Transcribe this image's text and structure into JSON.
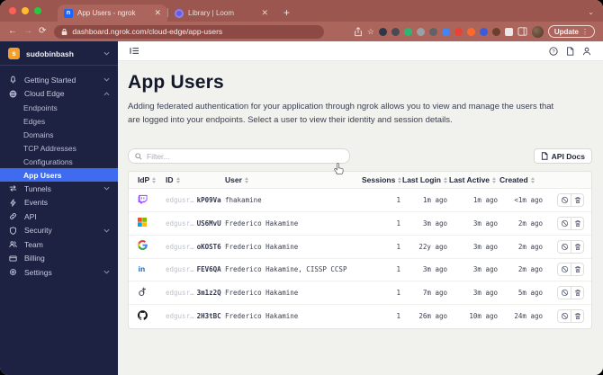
{
  "browser": {
    "tabs": [
      {
        "title": "App Users - ngrok",
        "favicon": "ngrok"
      },
      {
        "title": "Library | Loom",
        "favicon": "loom"
      }
    ],
    "url": "dashboard.ngrok.com/cloud-edge/app-users",
    "update_label": "Update",
    "extension_colors": [
      "#2d3748",
      "#4a4a55",
      "#2bb673",
      "#9aa0a6",
      "#5f6368",
      "#4285f4",
      "#e94235",
      "#ff6a2b",
      "#3b5bdb",
      "#6b3f2a",
      "#e8e8e8"
    ]
  },
  "sidebar": {
    "account_name": "sudobinbash",
    "account_initial": "s",
    "items": [
      {
        "id": "getting-started",
        "label": "Getting Started",
        "icon": "bell",
        "chevron": "down"
      },
      {
        "id": "cloud-edge",
        "label": "Cloud Edge",
        "icon": "globe",
        "chevron": "up",
        "children": [
          "Endpoints",
          "Edges",
          "Domains",
          "TCP Addresses",
          "Configurations",
          "App Users"
        ],
        "active_child": "App Users"
      },
      {
        "id": "tunnels",
        "label": "Tunnels",
        "icon": "tunnels",
        "chevron": "down"
      },
      {
        "id": "events",
        "label": "Events",
        "icon": "events"
      },
      {
        "id": "api",
        "label": "API",
        "icon": "api"
      },
      {
        "id": "security",
        "label": "Security",
        "icon": "security",
        "chevron": "down"
      },
      {
        "id": "team",
        "label": "Team",
        "icon": "team"
      },
      {
        "id": "billing",
        "label": "Billing",
        "icon": "billing"
      },
      {
        "id": "settings",
        "label": "Settings",
        "icon": "settings",
        "chevron": "down"
      }
    ]
  },
  "page": {
    "title": "App Users",
    "description": "Adding federated authentication for your application through ngrok allows you to view and manage the users that are logged into your endpoints. Select a user to view their identity and session details.",
    "filter_placeholder": "Filter...",
    "api_docs_label": "API Docs"
  },
  "table": {
    "columns": [
      "IdP",
      "ID",
      "User",
      "Sessions",
      "Last Login",
      "Last Active",
      "Created"
    ],
    "id_prefix": "edgusr…",
    "rows": [
      {
        "idp": "twitch",
        "id_suffix": "kP09Va",
        "user": "fhakamine",
        "sessions": "1",
        "last_login": "1m ago",
        "last_active": "1m ago",
        "created": "<1m ago"
      },
      {
        "idp": "microsoft",
        "id_suffix": "US6MvU",
        "user": "Frederico Hakamine",
        "sessions": "1",
        "last_login": "3m ago",
        "last_active": "3m ago",
        "created": "2m ago"
      },
      {
        "idp": "google",
        "id_suffix": "oKOST6",
        "user": "Frederico Hakamine",
        "sessions": "1",
        "last_login": "22y ago",
        "last_active": "3m ago",
        "created": "2m ago"
      },
      {
        "idp": "linkedin",
        "id_suffix": "FEV6QA",
        "user": "Frederico Hakamine, CISSP CCSP",
        "sessions": "1",
        "last_login": "3m ago",
        "last_active": "3m ago",
        "created": "2m ago"
      },
      {
        "idp": "custom-idp",
        "id_suffix": "3m1z2Q",
        "user": "Frederico Hakamine",
        "sessions": "1",
        "last_login": "7m ago",
        "last_active": "3m ago",
        "created": "5m ago"
      },
      {
        "idp": "github",
        "id_suffix": "2H3tBC",
        "user": "Frederico Hakamine",
        "sessions": "1",
        "last_login": "26m ago",
        "last_active": "10m ago",
        "created": "24m ago"
      }
    ]
  },
  "colors": {
    "accent": "#3f6bee",
    "sidebar_bg": "#1d2142",
    "chrome_dark": "#9a564f",
    "chrome_light": "#ac655c"
  }
}
